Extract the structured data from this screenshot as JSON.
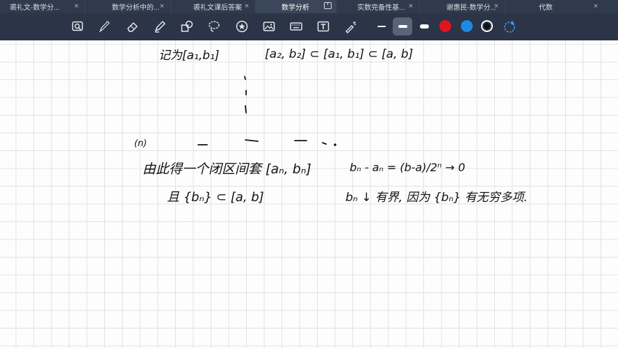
{
  "tabs": [
    {
      "label": "裘礼文-数学分...",
      "active": false
    },
    {
      "label": "数学分析中的...",
      "active": false
    },
    {
      "label": "裘礼文课后答案",
      "active": false
    },
    {
      "label": "数学分析",
      "active": true
    },
    {
      "label": "实数完备性基...",
      "active": false
    },
    {
      "label": "谢惠民-数学分...",
      "active": false
    },
    {
      "label": "代数",
      "active": false
    }
  ],
  "toolbar": {
    "tools": [
      "lasso-zoom-icon",
      "pen-icon",
      "eraser-icon",
      "highlighter-icon",
      "shapes-icon",
      "lasso-icon",
      "sticker-icon",
      "image-icon",
      "keyboard-icon",
      "text-box-icon",
      "laser-pointer-icon"
    ],
    "stroke_widths": [
      "thin",
      "medium",
      "thick"
    ],
    "selected_stroke": "medium",
    "colors": [
      "#e0151b",
      "#1e88e5",
      "#111111"
    ],
    "selected_color": "#111111"
  },
  "notes": {
    "line1_left": "记为[a₁,b₁]",
    "line1_right": "[a₂, b₂] ⊂ [a₁, b₁] ⊂ [a, b]",
    "label_n": "(n)",
    "line2_left": "由此得一个闭区间套 [aₙ, bₙ]",
    "line2_right": "bₙ - aₙ = (b-a)/2ⁿ → 0",
    "line3_left": "且 {bₙ} ⊂ [a, b]",
    "line3_right": "bₙ ↓ 有界,  因为 {bₙ} 有无穷多项."
  }
}
